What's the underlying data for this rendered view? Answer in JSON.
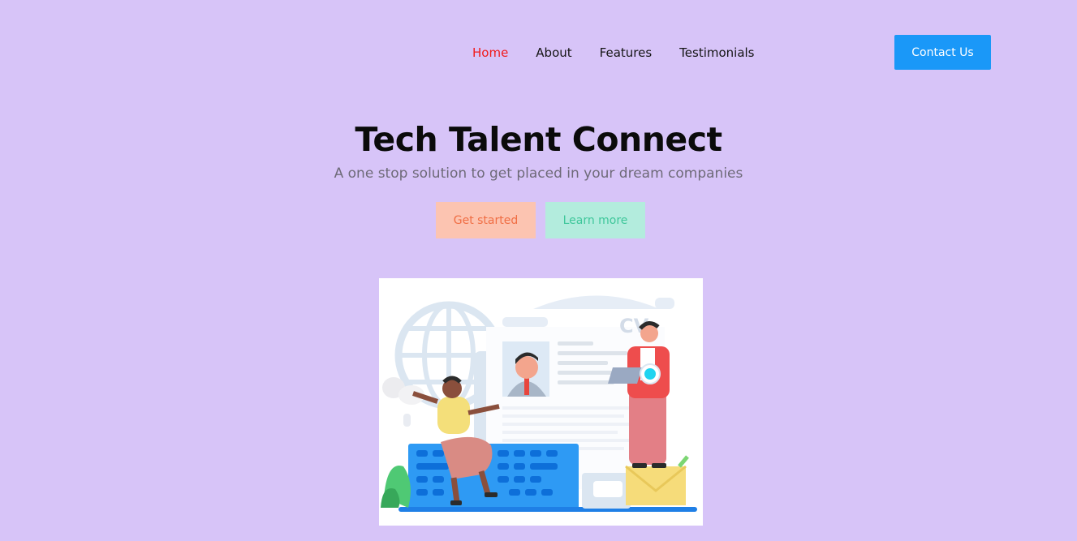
{
  "nav": {
    "links": [
      {
        "label": "Home",
        "active": true
      },
      {
        "label": "About",
        "active": false
      },
      {
        "label": "Features",
        "active": false
      },
      {
        "label": "Testimonials",
        "active": false
      }
    ],
    "contact_label": "Contact Us"
  },
  "hero": {
    "title": "Tech Talent Connect",
    "subtitle": "A one stop solution to get placed in your dream companies",
    "primary_cta": "Get started",
    "secondary_cta": "Learn more",
    "illustration_text": "CV"
  },
  "colors": {
    "background": "#d7c4f8",
    "accent_blue": "#1a98f8",
    "active_link": "#f01b1b",
    "get_started_bg": "#fcc4b1",
    "learn_more_bg": "#b3ecdd"
  }
}
